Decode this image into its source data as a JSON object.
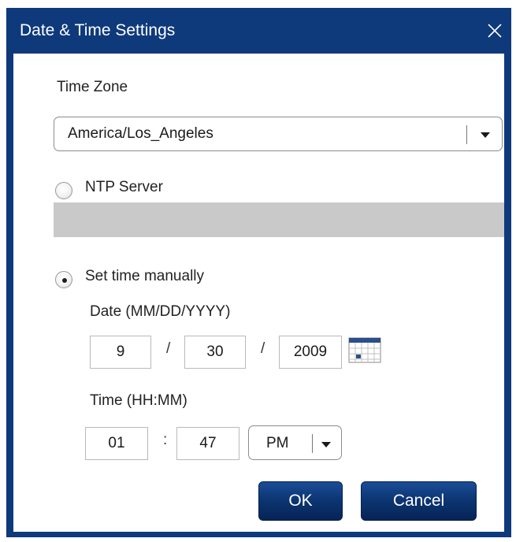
{
  "dialog": {
    "title": "Date & Time Settings"
  },
  "timezone": {
    "label": "Time Zone",
    "value": "America/Los_Angeles"
  },
  "ntp": {
    "label": "NTP Server",
    "selected": false,
    "value": ""
  },
  "manual": {
    "label": "Set time manually",
    "selected": true,
    "date_label": "Date (MM/DD/YYYY)",
    "month": "9",
    "day": "30",
    "year": "2009",
    "date_separator": "/",
    "time_label": "Time (HH:MM)",
    "hour": "01",
    "minute": "47",
    "time_separator": ":",
    "ampm": "PM"
  },
  "buttons": {
    "ok": "OK",
    "cancel": "Cancel"
  },
  "icons": {
    "close": "close-icon",
    "dropdown": "chevron-down-icon",
    "calendar": "calendar-icon"
  },
  "colors": {
    "title_bar": "#0e3a7c",
    "button": "#0d3674",
    "disabled_field": "#c9c9c9"
  }
}
